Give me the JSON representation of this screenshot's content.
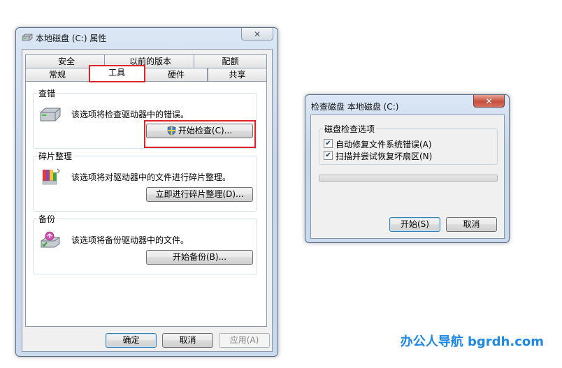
{
  "props_dialog": {
    "title": "本地磁盘 (C:) 属性",
    "close": "✕",
    "tabs_row1": [
      "安全",
      "以前的版本",
      "配额"
    ],
    "tabs_row2": [
      "常规",
      "工具",
      "硬件",
      "共享"
    ],
    "active_tab": "工具",
    "groups": {
      "check": {
        "label": "查错",
        "desc": "该选项将检查驱动器中的错误。",
        "button": "开始检查(C)..."
      },
      "defrag": {
        "label": "碎片整理",
        "desc": "该选项将对驱动器中的文件进行碎片整理。",
        "button": "立即进行碎片整理(D)..."
      },
      "backup": {
        "label": "备份",
        "desc": "该选项将备份驱动器中的文件。",
        "button": "开始备份(B)..."
      }
    },
    "buttons": {
      "ok": "确定",
      "cancel": "取消",
      "apply": "应用(A)"
    }
  },
  "check_dialog": {
    "title": "检查磁盘 本地磁盘 (C:)",
    "close": "✕",
    "group_label": "磁盘检查选项",
    "options": [
      {
        "label": "自动修复文件系统错误(A)",
        "checked": true
      },
      {
        "label": "扫描并尝试恢复坏扇区(N)",
        "checked": true
      }
    ],
    "progress": 0,
    "buttons": {
      "start": "开始(S)",
      "cancel": "取消"
    }
  },
  "watermark": "办公人导航 bgrdh.com",
  "colors": {
    "highlight": "#e0232b",
    "watermark": "#1e88e5",
    "close_red": "#c64f3d"
  },
  "icons": [
    "drive-icon",
    "check-drive-icon",
    "defrag-icon",
    "backup-icon",
    "uac-shield-icon"
  ]
}
